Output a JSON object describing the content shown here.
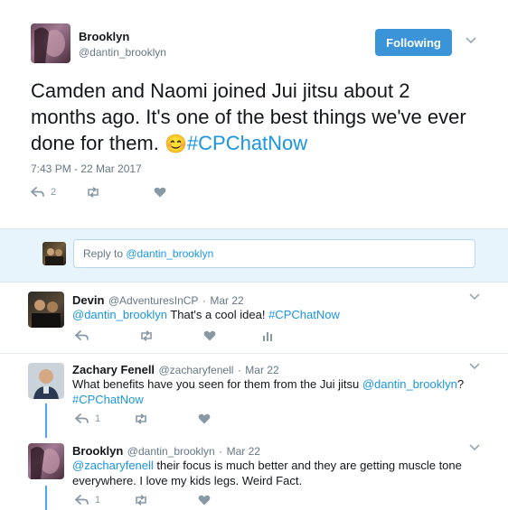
{
  "main_tweet": {
    "name": "Brooklyn",
    "handle": "@dantin_brooklyn",
    "follow_label": "Following",
    "text_line1": "Camden and Naomi joined Jui jitsu about 2",
    "text_line2": "months ago. It's one of the best things we've ever",
    "text_line3": "done for them.",
    "emoji": "😊",
    "hashtag": "#CPChatNow",
    "timestamp": "7:43 PM - 22 Mar 2017",
    "reply_count": "2"
  },
  "reply_box": {
    "prefix": "Reply to ",
    "mention": "@dantin_brooklyn"
  },
  "replies": [
    {
      "name": "Devin",
      "handle": "@AdventuresInCP",
      "date": "Mar 22",
      "mention": "@dantin_brooklyn",
      "text": " That's a cool idea! ",
      "hashtag": "#CPChatNow",
      "reply_count": ""
    },
    {
      "name": "Zachary Fenell",
      "handle": "@zacharyfenell",
      "date": "Mar 22",
      "text": "What benefits have you seen for them from the Jui jitsu ",
      "mention": "@dantin_brooklyn",
      "text_end": "?",
      "hashtag": "#CPChatNow",
      "reply_count": "1"
    },
    {
      "name": "Brooklyn",
      "handle": "@dantin_brooklyn",
      "date": "Mar 22",
      "mention": "@zacharyfenell",
      "text_line1": " their focus is much better and they are getting muscle tone",
      "text_line2": "everywhere. I love my kids legs. Weird Fact.",
      "reply_count": "1"
    }
  ],
  "colors": {
    "accent": "#1b95e0",
    "follow_bg": "#3c94d8",
    "muted": "#657786",
    "icon": "#8899a6",
    "reply_area_bg": "#e8f4fb",
    "thread_line": "#4ea8e6"
  },
  "icons": [
    "chevron-down-icon",
    "reply-icon",
    "retweet-icon",
    "like-icon",
    "analytics-icon"
  ]
}
